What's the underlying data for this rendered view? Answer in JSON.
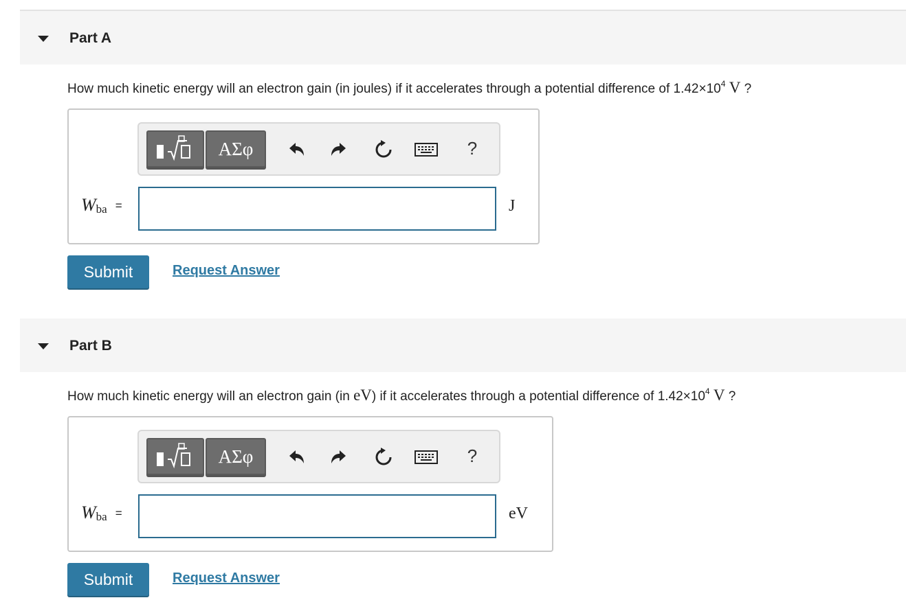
{
  "parts": [
    {
      "title": "Part A",
      "question_prefix": "How much kinetic energy will an electron gain (in joules) if it accelerates through a potential difference of 1.42×10",
      "question_exp": "4",
      "question_unit": "V",
      "question_suffix": "?",
      "var_main": "W",
      "var_sub": "ba",
      "equals": "=",
      "answer_value": "",
      "unit": "J",
      "toolbar": {
        "templates_icon": "templates-icon",
        "symbols_label": "ΑΣφ",
        "help_label": "?"
      },
      "submit_label": "Submit",
      "request_label": "Request Answer"
    },
    {
      "title": "Part B",
      "question_prefix": "How much kinetic energy will an electron gain (in",
      "question_unit_inline": "eV",
      "question_mid": ") if it accelerates through a potential difference of 1.42×10",
      "question_exp": "4",
      "question_unit": "V",
      "question_suffix": "?",
      "var_main": "W",
      "var_sub": "ba",
      "equals": "=",
      "answer_value": "",
      "unit": "eV",
      "toolbar": {
        "templates_icon": "templates-icon",
        "symbols_label": "ΑΣφ",
        "help_label": "?"
      },
      "submit_label": "Submit",
      "request_label": "Request Answer"
    }
  ],
  "colors": {
    "accent": "#2f7aa3",
    "input_border": "#2a6b8f",
    "header_bg": "#f5f5f5"
  },
  "icons": [
    "caret-down-icon",
    "templates-icon",
    "undo-icon",
    "redo-icon",
    "reset-icon",
    "keyboard-icon"
  ]
}
